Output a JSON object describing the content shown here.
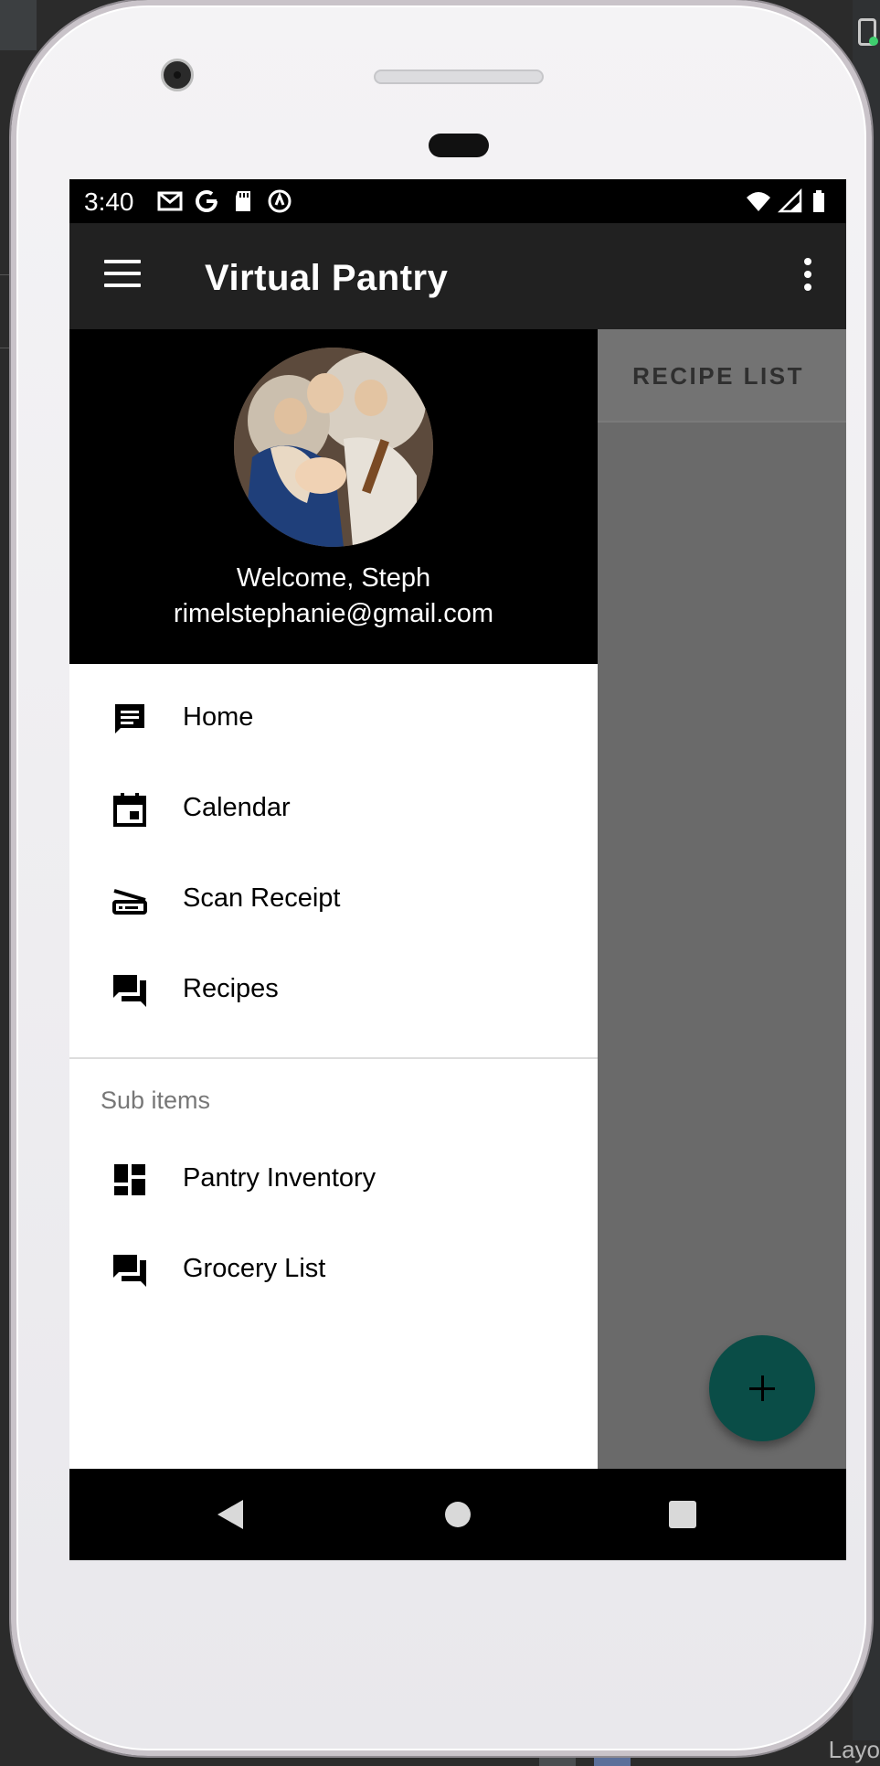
{
  "status_bar": {
    "time": "3:40"
  },
  "app_bar": {
    "title": "Virtual Pantry"
  },
  "background": {
    "tab_label": "RECIPE LIST"
  },
  "drawer": {
    "header": {
      "welcome": "Welcome, Steph",
      "email": "rimelstephanie@gmail.com"
    },
    "items": [
      {
        "label": "Home",
        "icon": "message-icon"
      },
      {
        "label": "Calendar",
        "icon": "calendar-icon"
      },
      {
        "label": "Scan Receipt",
        "icon": "scanner-icon"
      },
      {
        "label": "Recipes",
        "icon": "forum-icon"
      }
    ],
    "subheader": "Sub items",
    "sub_items": [
      {
        "label": "Pantry Inventory",
        "icon": "dashboard-icon"
      },
      {
        "label": "Grocery List",
        "icon": "forum-icon"
      }
    ]
  },
  "ide": {
    "bottom_text": "Layo"
  },
  "colors": {
    "app_bar": "#212121",
    "drawer_header": "#000000",
    "fab": "#0a4d47",
    "scrim": "#6a6a6a"
  }
}
